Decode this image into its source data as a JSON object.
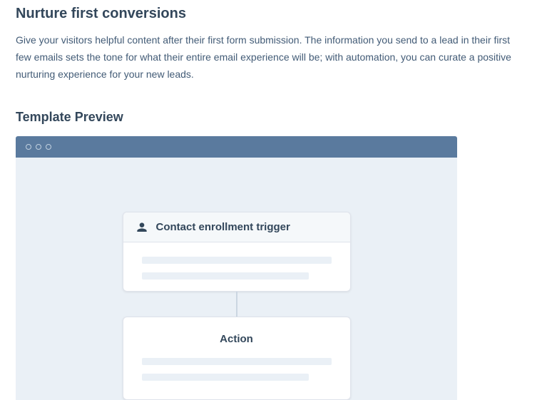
{
  "page": {
    "title": "Nurture first conversions",
    "description": "Give your visitors helpful content after their first form submission. The information you send to a lead in their first few emails sets the tone for what their entire email experience will be; with automation, you can curate a positive nurturing experience for your new leads."
  },
  "preview": {
    "heading": "Template Preview",
    "trigger_card": {
      "title": "Contact enrollment trigger"
    },
    "action_card": {
      "title": "Action"
    }
  }
}
